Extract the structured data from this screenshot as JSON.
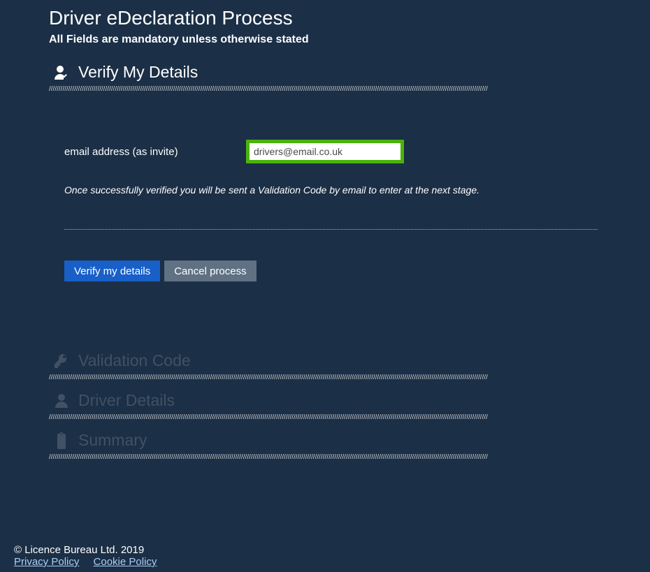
{
  "pageTitle": "Driver eDeclaration Process",
  "subtitle": "All Fields are mandatory unless otherwise stated",
  "steps": {
    "verifyDetails": {
      "title": "Verify My Details",
      "emailLabel": "email address (as invite)",
      "emailValue": "drivers@email.co.uk",
      "hint": "Once successfully verified you will be sent a Validation Code by email to enter at the next stage.",
      "verifyBtn": "Verify my details",
      "cancelBtn": "Cancel process"
    },
    "validationCode": {
      "title": "Validation Code"
    },
    "driverDetails": {
      "title": "Driver Details"
    },
    "summary": {
      "title": "Summary"
    }
  },
  "footer": {
    "copyright": "© Licence Bureau Ltd. 2019",
    "privacy": "Privacy Policy",
    "cookie": "Cookie Policy"
  },
  "hashLine": "//////////////////////////////////////////////////////////////////////////////////////////////////////////////////////////////////////////////////////////////////////////////////////////////////////////////////////////////////"
}
